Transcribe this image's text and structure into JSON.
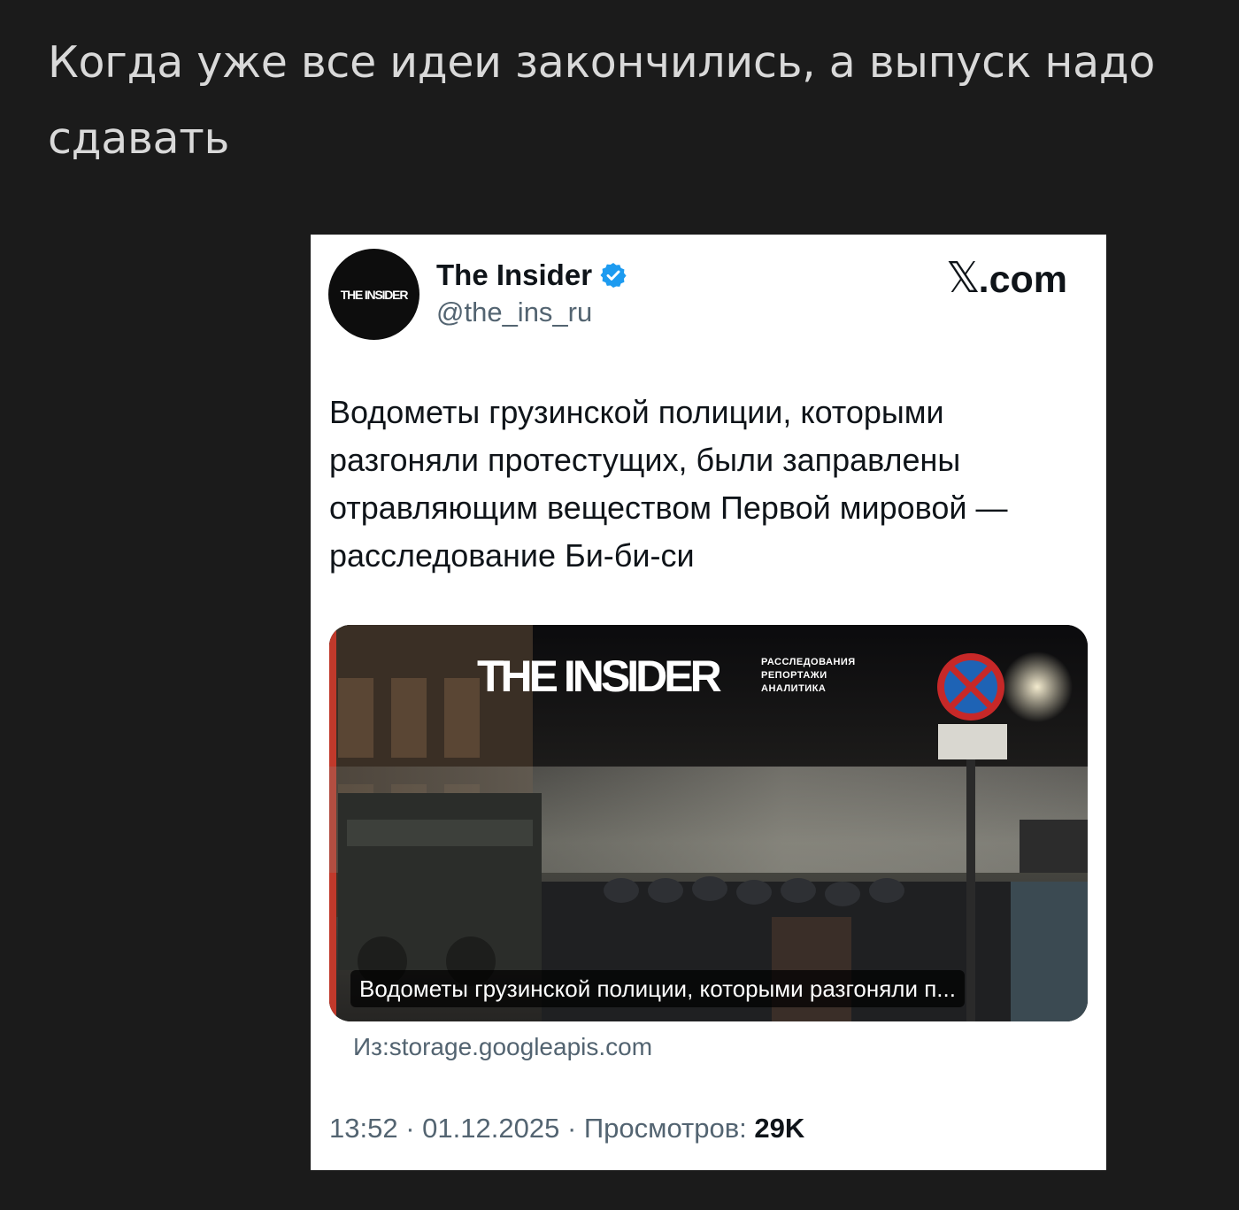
{
  "post": {
    "title": "Когда уже все идеи закончились, а выпуск надо сдавать"
  },
  "tweet": {
    "avatar_text": "THE INSIDER",
    "display_name": "The Insider",
    "handle": "@the_ins_ru",
    "platform_logo_mark": "𝕏",
    "platform_logo_text": ".com",
    "text": "Водометы грузинской полиции, которыми разгоняли протестущих, были заправлены отравляющим веществом Первой мировой — расследование Би-би-си",
    "media": {
      "brand_logo": "THE INSIDER",
      "brand_tags": [
        "РАССЛЕДОВАНИЯ",
        "РЕПОРТАЖИ",
        "АНАЛИТИКА"
      ],
      "caption": "Водометы грузинской полиции, которыми разгоняли п..."
    },
    "link_source": "Из:storage.googleapis.com",
    "time": "13:52",
    "separator": "·",
    "date": "01.12.2025",
    "views_label": "Просмотров:",
    "views_count": "29K",
    "verified_icon": "verified-badge-icon",
    "verified_color": "#1d9bf0"
  },
  "colors": {
    "page_background": "#1b1b1b",
    "title_text": "#d9d9d9",
    "card_background": "#ffffff",
    "secondary_text": "#536471",
    "primary_text": "#0f1419"
  }
}
